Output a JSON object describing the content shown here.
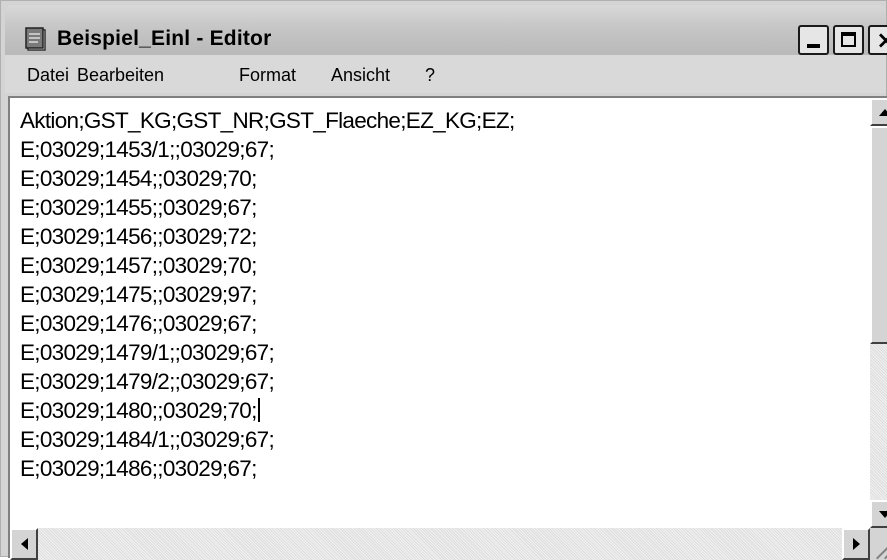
{
  "window": {
    "title": "Beispiel_Einl - Editor",
    "controls": {
      "minimize": "minimize-icon",
      "maximize": "maximize-icon",
      "close": "close-icon"
    }
  },
  "menu": [
    "Datei",
    "Bearbeiten",
    "Format",
    "Ansicht",
    "?"
  ],
  "editor": {
    "lines": [
      "Aktion;GST_KG;GST_NR;GST_Flaeche;EZ_KG;EZ;",
      "E;03029;1453/1;;03029;67;",
      "E;03029;1454;;03029;70;",
      "E;03029;1455;;03029;67;",
      "E;03029;1456;;03029;72;",
      "E;03029;1457;;03029;70;",
      "E;03029;1475;;03029;97;",
      "E;03029;1476;;03029;67;",
      "E;03029;1479/1;;03029;67;",
      "E;03029;1479/2;;03029;67;",
      "E;03029;1480;;03029;70;",
      "E;03029;1484/1;;03029;67;",
      "E;03029;1486;;03029;67;"
    ]
  }
}
